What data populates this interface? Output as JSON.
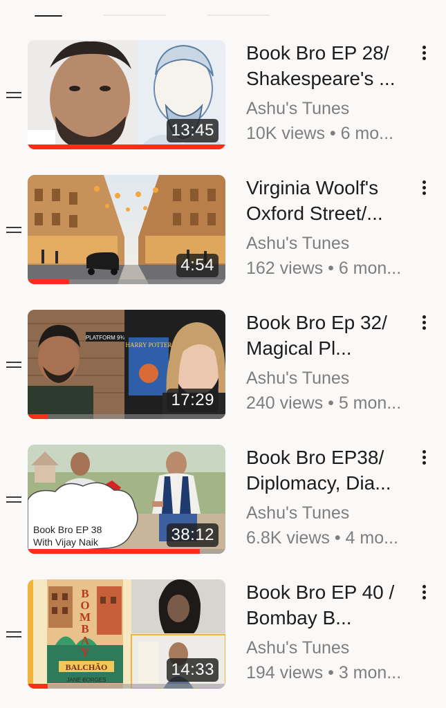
{
  "videos": [
    {
      "title": "Book Bro EP 28/ Shakespeare's ...",
      "channel": "Ashu's Tunes",
      "meta": "10K views • 6 mo...",
      "duration": "13:45",
      "watched_fraction": 1.0
    },
    {
      "title": "Virginia Woolf's Oxford Street/...",
      "channel": "Ashu's Tunes",
      "meta": "162 views • 6 mon...",
      "duration": "4:54",
      "watched_fraction": 0.21
    },
    {
      "title": "Book Bro Ep 32/ Magical Pl...",
      "channel": "Ashu's Tunes",
      "meta": "240 views • 5 mon...",
      "duration": "17:29",
      "watched_fraction": 0.1
    },
    {
      "title": "Book Bro EP38/ Diplomacy, Dia...",
      "channel": "Ashu's Tunes",
      "meta": "6.8K views • 4 mo...",
      "duration": "38:12",
      "watched_fraction": 0.87,
      "thumb_text_1": "Book Bro EP 38",
      "thumb_text_2": "With Vijay Naik"
    },
    {
      "title": "Book Bro EP 40 / Bombay B...",
      "channel": "Ashu's Tunes",
      "meta": "194 views • 3 mon...",
      "duration": "14:33",
      "watched_fraction": 0.1,
      "cover_title": "BOMBAY",
      "cover_subtitle": "BALCHÃO",
      "cover_author": "JANE BORGES"
    }
  ],
  "thumb_3_sign": "PLATFORM 9¾",
  "thumb_3_book": "HARRY POTTER",
  "colors": {
    "progress": "#ff2d18",
    "background": "#fbf9f8"
  }
}
